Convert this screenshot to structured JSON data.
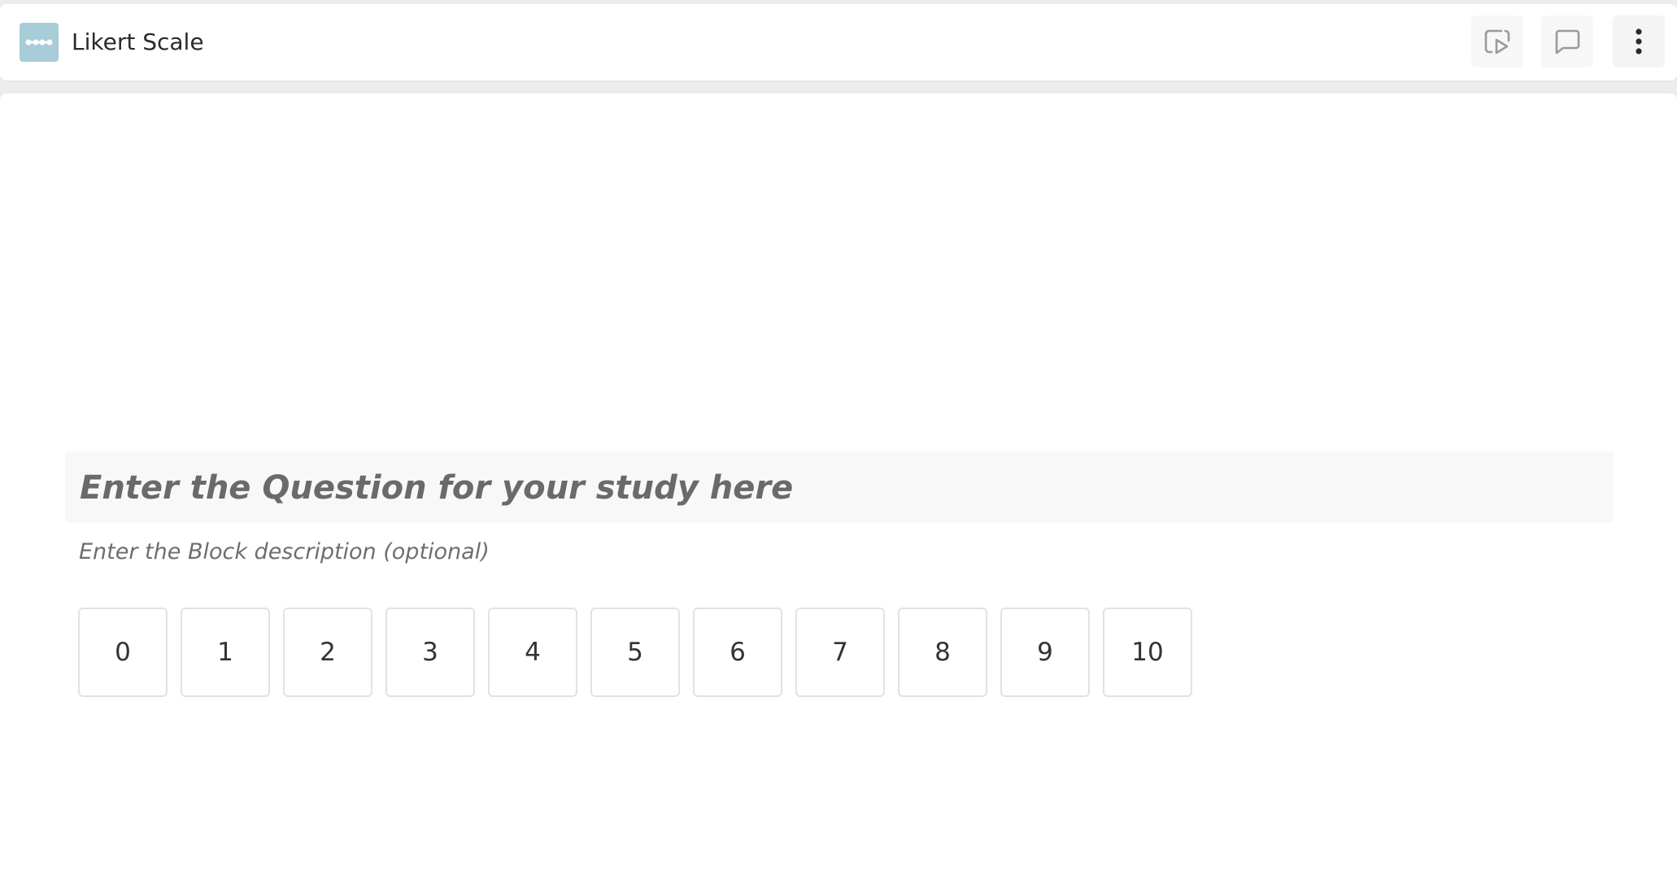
{
  "header": {
    "title": "Likert Scale",
    "block_icon": "likert-scale-icon",
    "block_icon_color": "#a7cdd8",
    "actions": [
      {
        "name": "preview-button",
        "icon": "play-preview-icon"
      },
      {
        "name": "comment-button",
        "icon": "comment-icon"
      },
      {
        "name": "more-options-button",
        "icon": "vertical-dots-icon"
      }
    ]
  },
  "block": {
    "question_placeholder": "Enter the Question for your study here",
    "description_placeholder": "Enter the Block description (optional)",
    "scale_options": [
      "0",
      "1",
      "2",
      "3",
      "4",
      "5",
      "6",
      "7",
      "8",
      "9",
      "10"
    ]
  },
  "colors": {
    "page_background": "#ededed",
    "surface": "#ffffff",
    "option_border": "#e2e2e2",
    "placeholder_text": "#6a6a6a"
  }
}
